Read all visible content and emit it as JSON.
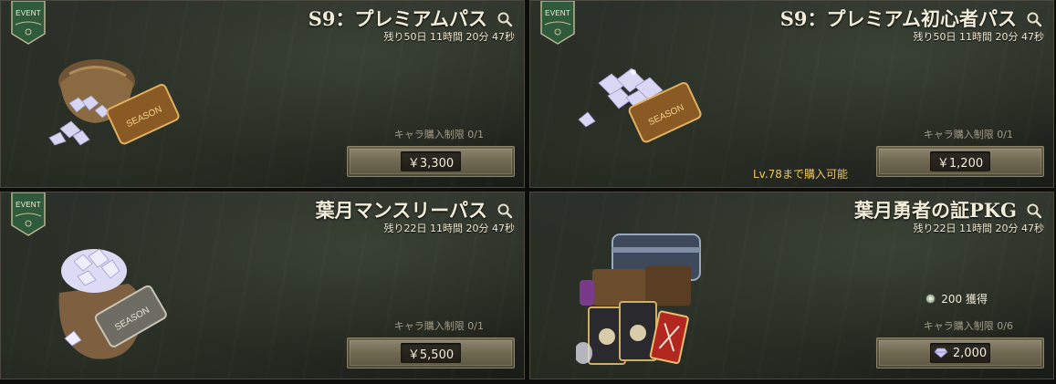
{
  "event_badge": "EVENT",
  "cards": [
    {
      "title": "S9：プレミアムパス",
      "timer": "残り50日 11時間 20分 47秒",
      "limit": "キャラ購入制限 0/1",
      "price": "￥3,300",
      "ticket": "SEASON"
    },
    {
      "title": "S9：プレミアム初心者パス",
      "timer": "残り50日 11時間 20分 47秒",
      "limit": "キャラ購入制限 0/1",
      "requirement": "Lv.78まで購入可能",
      "price": "￥1,200",
      "ticket": "SEASON"
    },
    {
      "title": "葉月マンスリーパス",
      "timer": "残り22日 11時間 20分 47秒",
      "limit": "キャラ購入制限 0/1",
      "price": "￥5,500",
      "ticket": "SEASON"
    },
    {
      "title": "葉月勇者の証PKG",
      "timer": "残り22日 11時間 20分 47秒",
      "reward": "200 獲得",
      "limit": "キャラ購入制限 0/6",
      "price": "2,000",
      "price_icon": "diamond-icon"
    }
  ],
  "colors": {
    "badge_green": "#2f5b3c",
    "title": "#f2ecd8",
    "requirement": "#f0c85a",
    "limit": "#a29c88",
    "button": "#7a725a"
  }
}
